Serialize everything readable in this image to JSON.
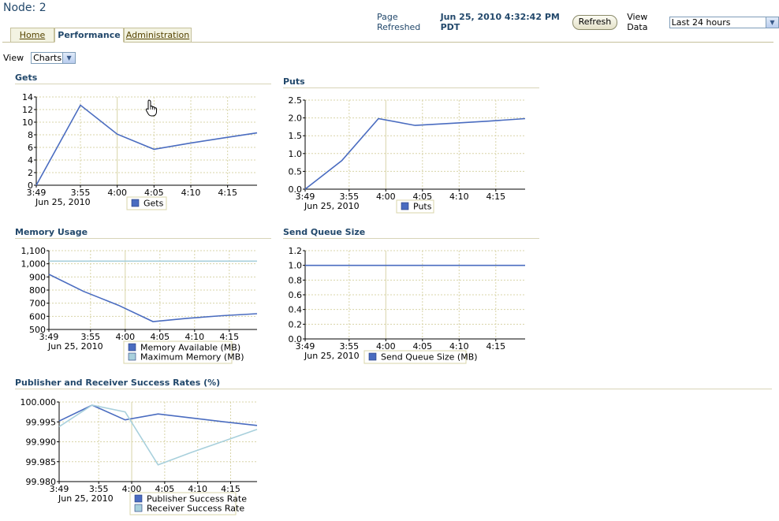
{
  "page": {
    "title": "Node: 2"
  },
  "header": {
    "refreshed_label": "Page Refreshed",
    "refreshed_time": "Jun 25, 2010 4:32:42 PM PDT",
    "refresh_button": "Refresh",
    "view_data_label": "View Data",
    "view_data_value": "Last 24 hours"
  },
  "tabs": [
    {
      "label": "Home",
      "active": false
    },
    {
      "label": "Performance",
      "active": true
    },
    {
      "label": "Administration",
      "active": false
    }
  ],
  "view": {
    "label": "View",
    "value": "Charts"
  },
  "colors": {
    "series1": "#4a6cc0",
    "series2": "#a8d0dc",
    "grid": "#d8d4a8",
    "title": "#22486b"
  },
  "chart_data": [
    {
      "type": "line",
      "title": "Gets",
      "x": [
        "3:49",
        "3:55",
        "4:00",
        "4:05",
        "4:10",
        "4:15"
      ],
      "date_label": "Jun 25, 2010",
      "ylim": [
        0,
        14
      ],
      "yticks": [
        "0",
        "2",
        "4",
        "6",
        "8",
        "10",
        "12",
        "14"
      ],
      "series": [
        {
          "name": "Gets",
          "points": [
            [
              0,
              0
            ],
            [
              6,
              12.7
            ],
            [
              11,
              8.1
            ],
            [
              16,
              5.7
            ],
            [
              21,
              6.7
            ],
            [
              26,
              7.6
            ],
            [
              30,
              8.3
            ]
          ]
        }
      ]
    },
    {
      "type": "line",
      "title": "Puts",
      "x": [
        "3:49",
        "3:55",
        "4:00",
        "4:05",
        "4:10",
        "4:15"
      ],
      "date_label": "Jun 25, 2010",
      "ylim": [
        0,
        2.5
      ],
      "yticks": [
        "0.0",
        "0.5",
        "1.0",
        "1.5",
        "2.0",
        "2.5"
      ],
      "series": [
        {
          "name": "Puts",
          "points": [
            [
              0,
              0
            ],
            [
              5,
              0.8
            ],
            [
              10,
              1.98
            ],
            [
              15,
              1.79
            ],
            [
              20,
              1.85
            ],
            [
              25,
              1.91
            ],
            [
              30,
              1.98
            ]
          ]
        }
      ]
    },
    {
      "type": "line",
      "title": "Memory Usage",
      "x": [
        "3:49",
        "3:55",
        "4:00",
        "4:05",
        "4:10",
        "4:15"
      ],
      "date_label": "Jun 25, 2010",
      "ylim": [
        500,
        1100
      ],
      "yticks": [
        "500",
        "600",
        "700",
        "800",
        "900",
        "1,000",
        "1,100"
      ],
      "series": [
        {
          "name": "Memory Available (MB)",
          "points": [
            [
              0,
              920
            ],
            [
              5,
              790
            ],
            [
              10,
              685
            ],
            [
              15,
              560
            ],
            [
              20,
              585
            ],
            [
              25,
              605
            ],
            [
              30,
              620
            ]
          ]
        },
        {
          "name": "Maximum Memory (MB)",
          "points": [
            [
              0,
              1020
            ],
            [
              30,
              1020
            ]
          ]
        }
      ]
    },
    {
      "type": "line",
      "title": "Send Queue Size",
      "x": [
        "3:49",
        "3:55",
        "4:00",
        "4:05",
        "4:10",
        "4:15"
      ],
      "date_label": "Jun 25, 2010",
      "ylim": [
        0,
        1.2
      ],
      "yticks": [
        "0.0",
        "0.2",
        "0.4",
        "0.6",
        "0.8",
        "1.0",
        "1.2"
      ],
      "series": [
        {
          "name": "Send Queue Size (MB)",
          "points": [
            [
              0,
              1.0
            ],
            [
              30,
              1.0
            ]
          ]
        }
      ]
    },
    {
      "type": "line",
      "title": "Publisher and Receiver Success Rates (%)",
      "x": [
        "3:49",
        "3:55",
        "4:00",
        "4:05",
        "4:10",
        "4:15"
      ],
      "date_label": "Jun 25, 2010",
      "ylim": [
        99.98,
        100.0
      ],
      "yticks": [
        "99.980",
        "99.985",
        "99.990",
        "99.995",
        "100.000"
      ],
      "series": [
        {
          "name": "Publisher Success Rate",
          "points": [
            [
              0,
              99.9952
            ],
            [
              5,
              99.9992
            ],
            [
              10,
              99.9955
            ],
            [
              15,
              99.997
            ],
            [
              20,
              99.996
            ],
            [
              25,
              99.995
            ],
            [
              30,
              99.9941
            ]
          ]
        },
        {
          "name": "Receiver Success Rate",
          "points": [
            [
              0,
              99.9938
            ],
            [
              5,
              99.9992
            ],
            [
              10,
              99.9975
            ],
            [
              15,
              99.9842
            ],
            [
              20,
              99.9873
            ],
            [
              25,
              99.9902
            ],
            [
              30,
              99.9931
            ]
          ]
        }
      ]
    }
  ]
}
